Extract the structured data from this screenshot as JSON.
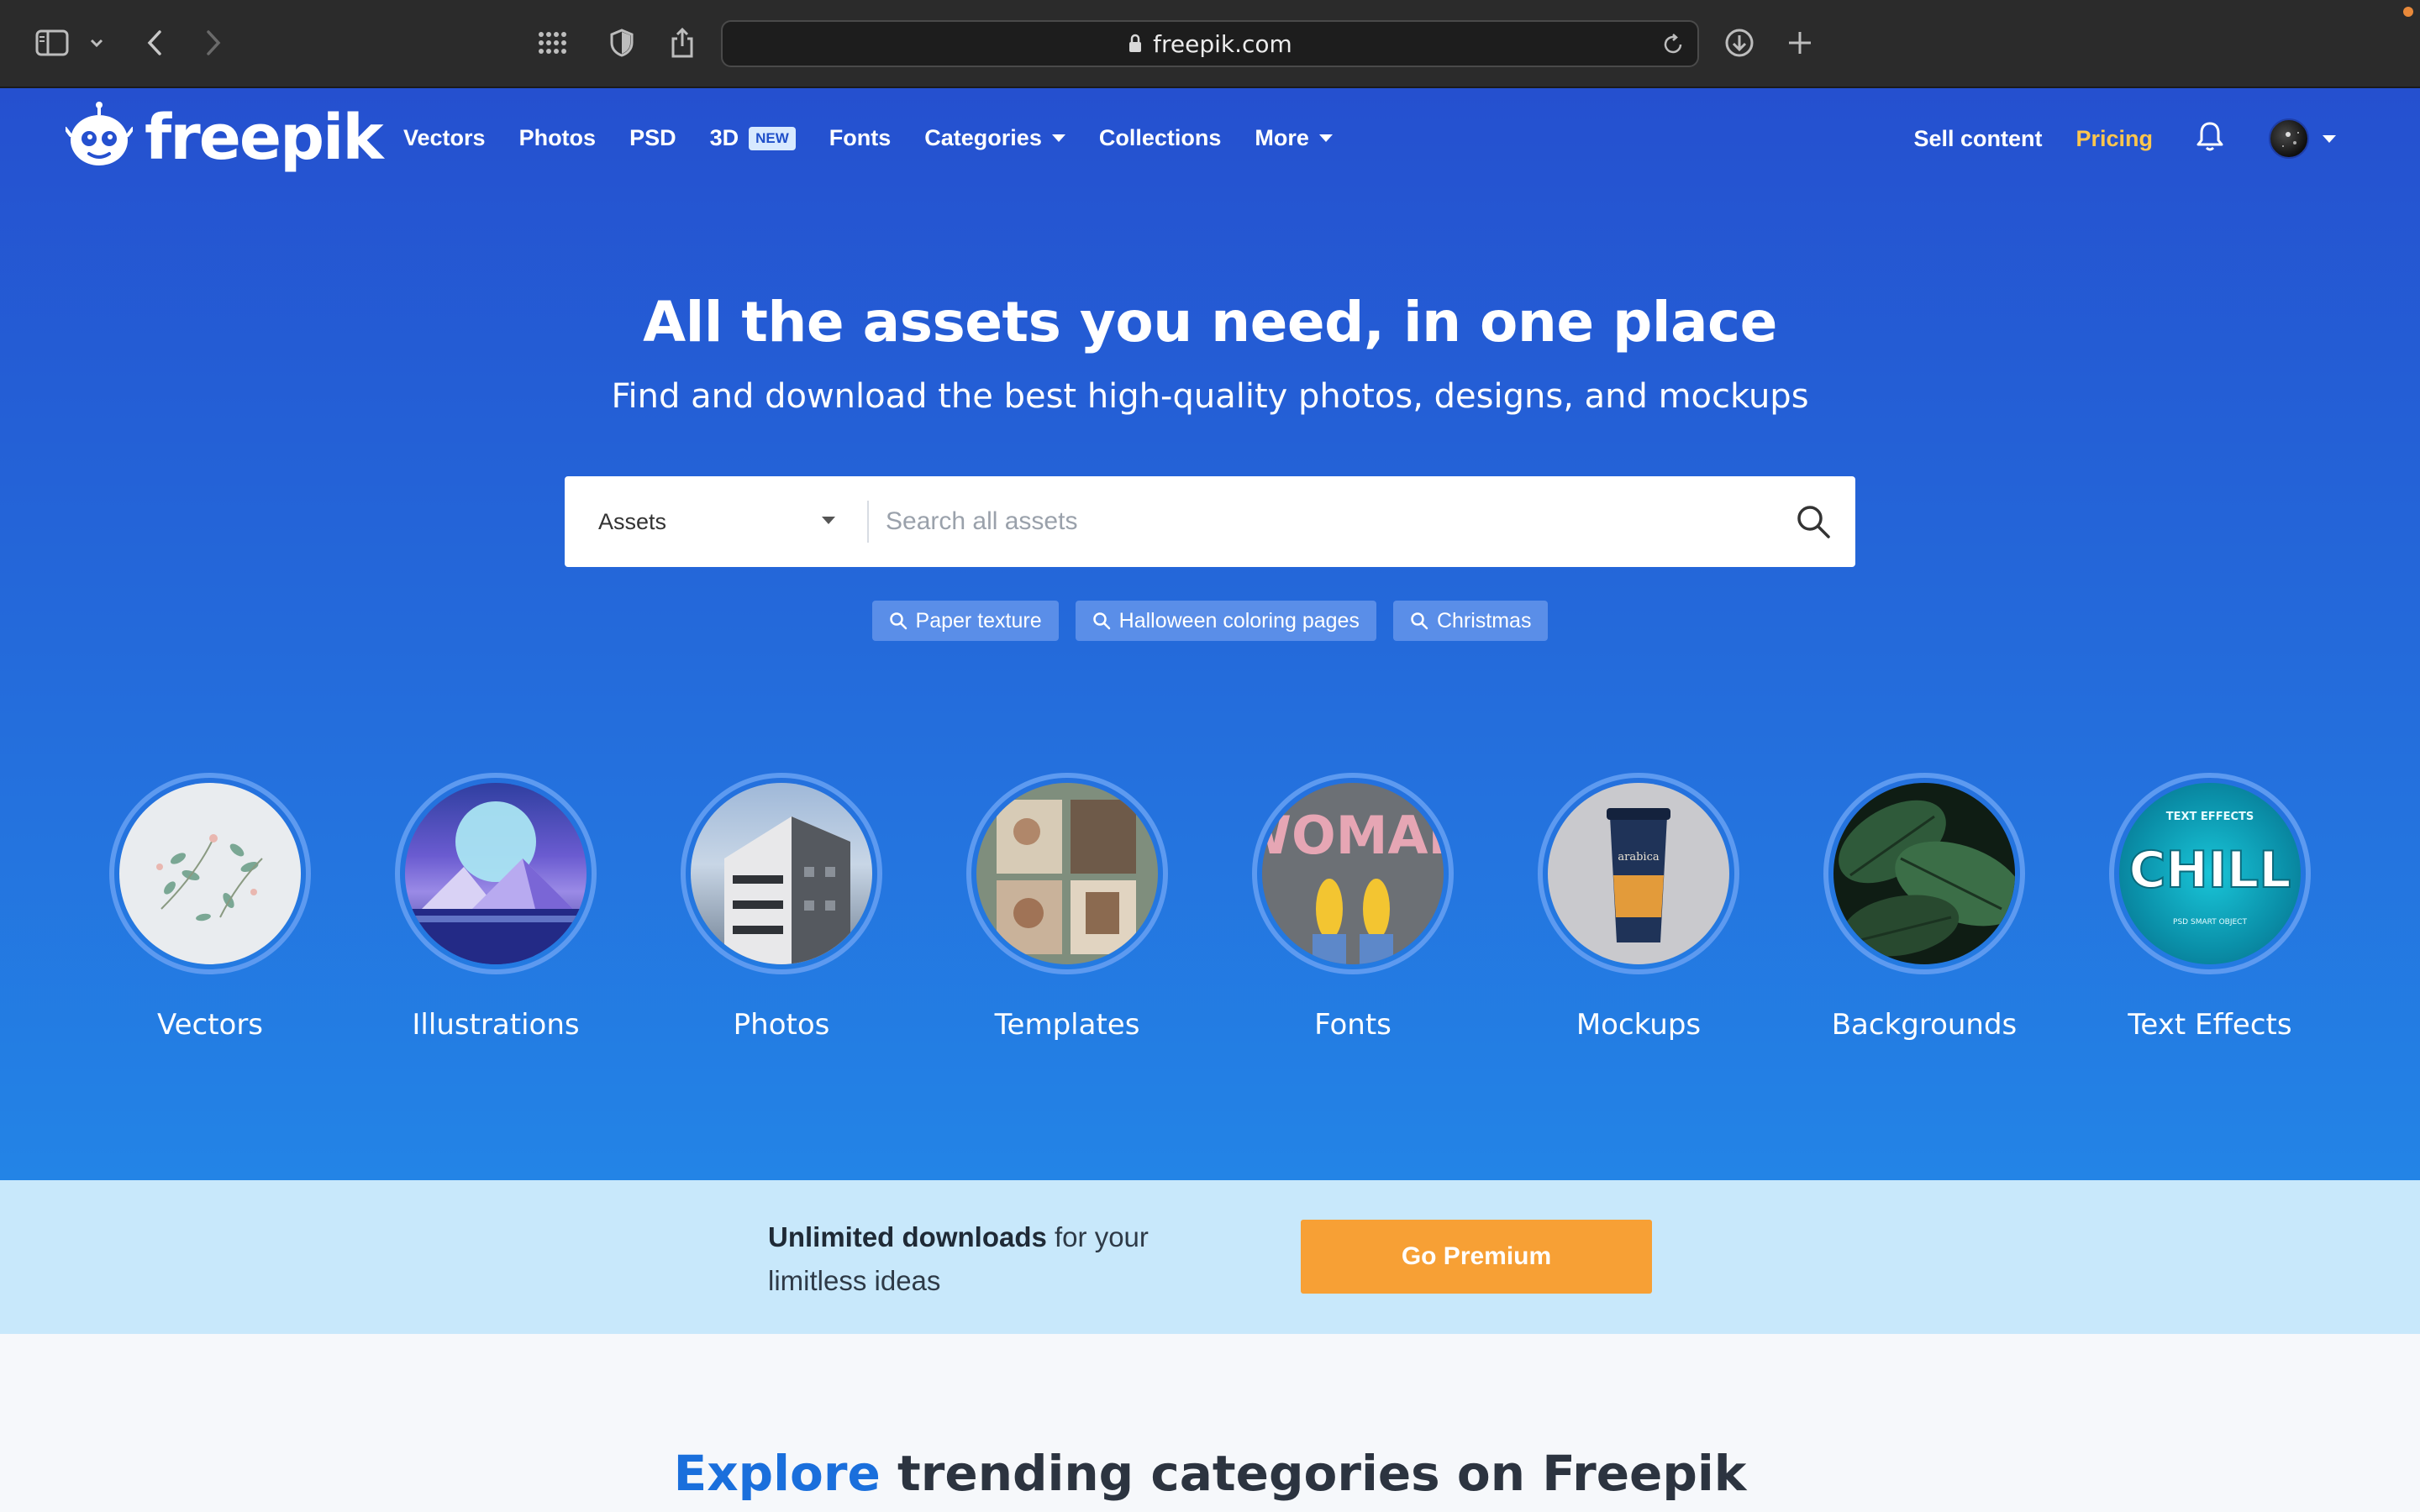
{
  "browser": {
    "url": "freepik.com"
  },
  "header": {
    "logo_text": "freepik",
    "nav": [
      {
        "label": "Vectors"
      },
      {
        "label": "Photos"
      },
      {
        "label": "PSD"
      },
      {
        "label": "3D",
        "badge": "NEW"
      },
      {
        "label": "Fonts"
      },
      {
        "label": "Categories",
        "dropdown": true
      },
      {
        "label": "Collections"
      },
      {
        "label": "More",
        "dropdown": true
      }
    ],
    "sell_content": "Sell content",
    "pricing": "Pricing"
  },
  "hero": {
    "title": "All the assets you need, in one place",
    "subtitle": "Find and download the best high-quality photos, designs, and mockups",
    "search": {
      "category": "Assets",
      "placeholder": "Search all assets"
    },
    "suggestions": [
      "Paper texture",
      "Halloween coloring pages",
      "Christmas"
    ]
  },
  "categories": [
    {
      "label": "Vectors"
    },
    {
      "label": "Illustrations"
    },
    {
      "label": "Photos"
    },
    {
      "label": "Templates"
    },
    {
      "label": "Fonts",
      "thumb_text": "WOMAN"
    },
    {
      "label": "Mockups",
      "thumb_text": "arabica"
    },
    {
      "label": "Backgrounds"
    },
    {
      "label": "Text Effects",
      "thumb_text": "CHILL",
      "thumb_top": "TEXT EFFECTS",
      "thumb_bottom": "PSD SMART OBJECT"
    }
  ],
  "premium": {
    "bold": "Unlimited downloads",
    "rest": " for your limitless ideas",
    "button": "Go Premium"
  },
  "explore": {
    "highlight": "Explore",
    "rest": " trending categories on Freepik"
  },
  "colors": {
    "brand_blue": "#2550cf",
    "pricing": "#ffc64d",
    "premium_button": "#f7a035",
    "premium_bg": "#c8e8fb"
  }
}
